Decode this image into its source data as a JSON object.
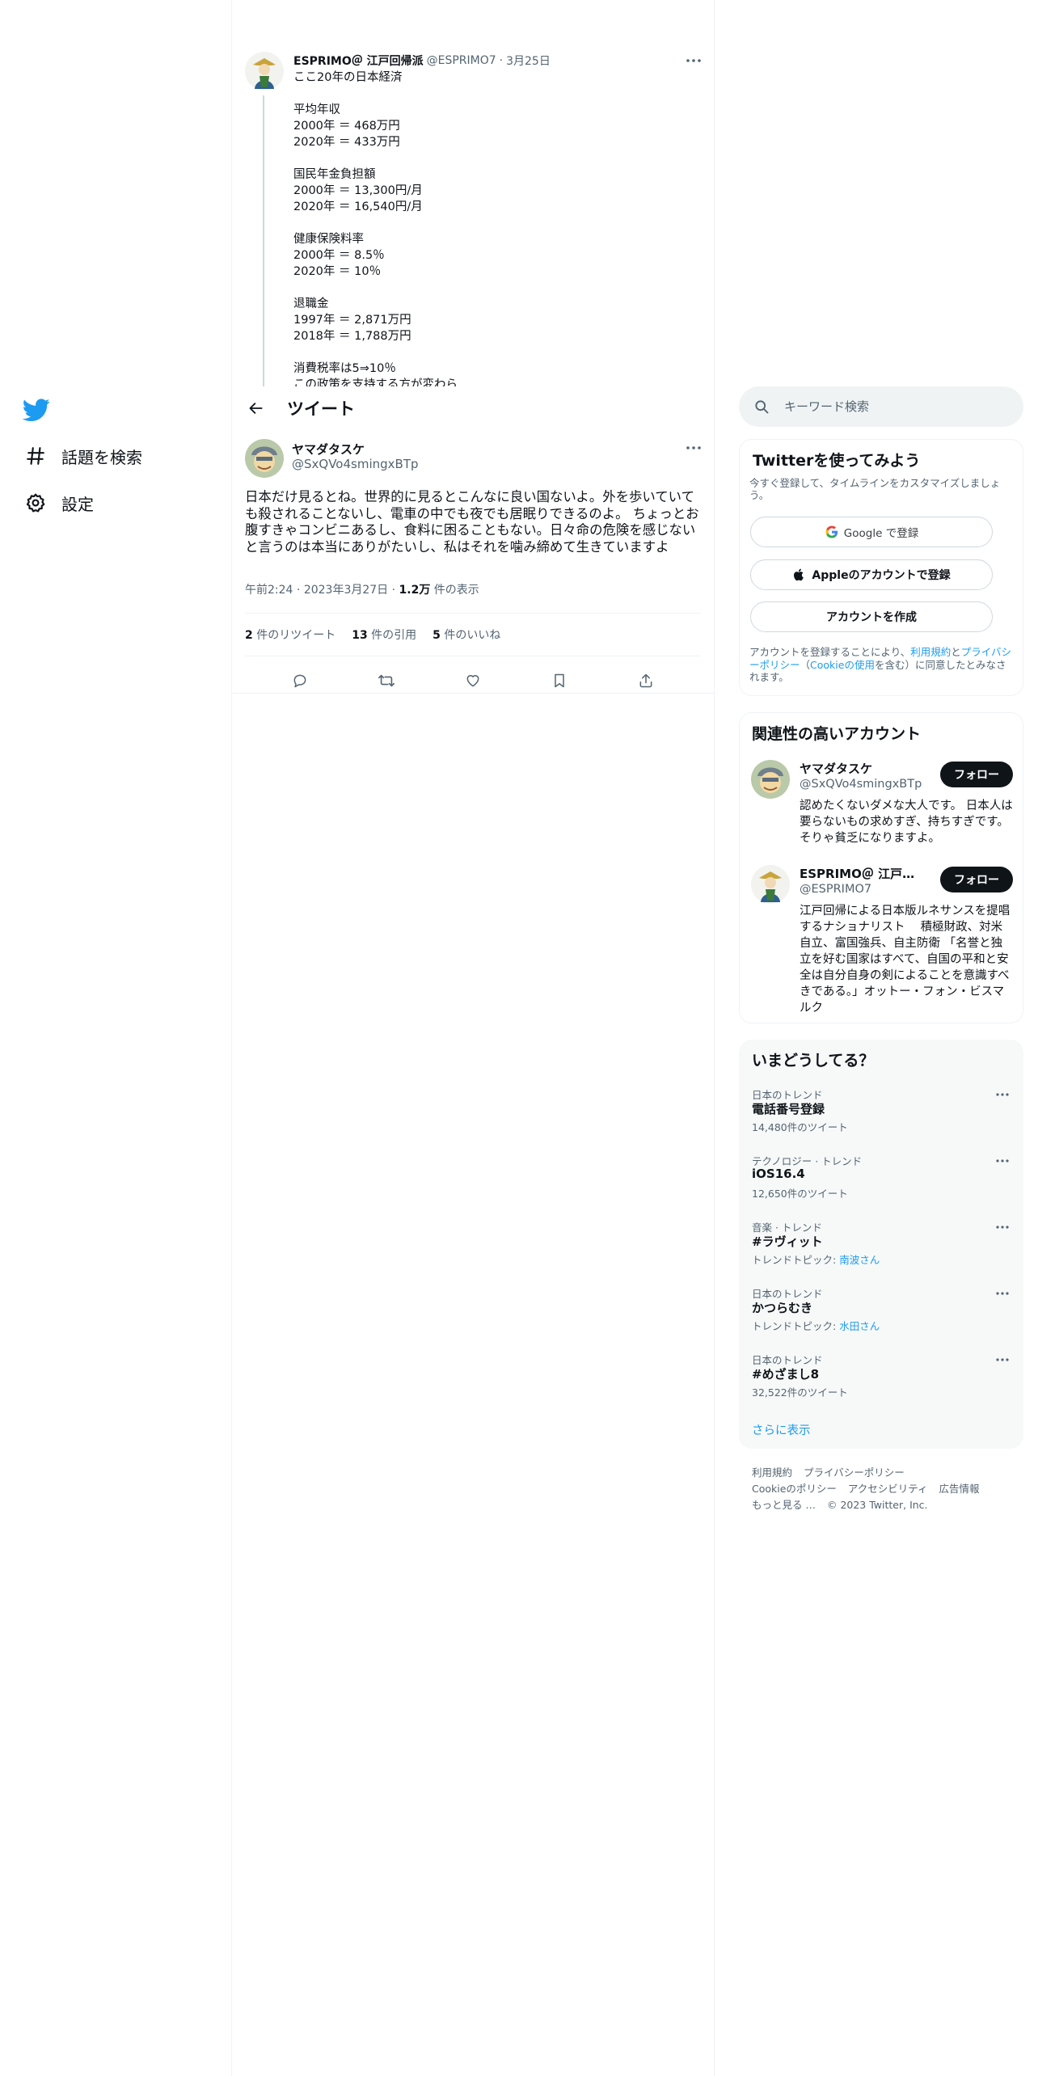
{
  "nav": {
    "items": [
      {
        "label": "話題を検索",
        "icon": "hashtag-icon"
      },
      {
        "label": "設定",
        "icon": "gear-icon"
      }
    ]
  },
  "parent_tweet": {
    "name": "ESPRIMO＠ 江戸回帰派",
    "handle": "@ESPRIMO7",
    "sep": "·",
    "date": "3月25日",
    "text": "ここ20年の日本経済\n\n平均年収\n2000年 ＝ 468万円\n2020年 ＝ 433万円\n\n国民年金負担額\n2000年 ＝ 13,300円/月\n2020年 ＝ 16,540円/月\n\n健康保険料率\n2000年 ＝ 8.5％\n2020年 ＝ 10％\n\n退職金\n1997年 ＝ 2,871万円\n2018年 ＝ 1,788万円\n\n消費税率は5⇒10％\nこの政策を支持する方が変わら"
  },
  "header": {
    "title": "ツイート"
  },
  "tweet": {
    "name": "ヤマダタスケ",
    "handle": "@SxQVo4smingxBTp",
    "text": "日本だけ見るとね。世界的に見るとこんなに良い国ないよ。外を歩いていても殺されることないし、電車の中でも夜でも居眠りできるのよ。 ちょっとお腹すきゃコンビニあるし、食料に困ることもない。日々命の危険を感じないと言うのは本当にありがたいし、私はそれを噛み締めて生きていますよ",
    "time": "午前2:24",
    "sep": "·",
    "date": "2023年3月27日",
    "views_count": "1.2万",
    "views_label": " 件の表示",
    "retweets_count": "2",
    "retweets_label": " 件のリツイート",
    "quotes_count": "13",
    "quotes_label": " 件の引用",
    "likes_count": "5",
    "likes_label": " 件のいいね"
  },
  "search": {
    "placeholder": "キーワード検索"
  },
  "signup": {
    "title": "Twitterを使ってみよう",
    "subtitle": "今すぐ登録して、タイムラインをカスタマイズしましょう。",
    "google_label": "Google で登録",
    "apple_label": "Appleのアカウントで登録",
    "create_label": "アカウントを作成",
    "legal_pre": "アカウントを登録することにより、",
    "legal_terms": "利用規約",
    "legal_and": "と",
    "legal_privacy": "プライバシーポリシー",
    "legal_paren_open": "（",
    "legal_cookie": "Cookieの使用",
    "legal_post": "を含む）に同意したとみなされます。"
  },
  "related": {
    "title": "関連性の高いアカウント",
    "accounts": [
      {
        "name": "ヤマダタスケ",
        "handle": "@SxQVo4smingxBTp",
        "follow": "フォロー",
        "bio": "認めたくないダメな大人です。 日本人は要らないもの求めすぎ、持ちすぎです。そりゃ貧乏になりますよ。"
      },
      {
        "name": "ESPRIMO＠ 江戸回帰派",
        "handle": "@ESPRIMO7",
        "follow": "フォロー",
        "bio": "江戸回帰による日本版ルネサンスを提唱するナショナリスト　 積極財政、対米自立、富国強兵、自主防衛 「名誉と独立を好む国家はすべて、自国の平和と安全は自分自身の剣によることを意識すべきである。」オットー・フォン・ビスマルク"
      }
    ]
  },
  "trends": {
    "title": "いまどうしてる？",
    "items": [
      {
        "context": "日本のトレンド",
        "name": "電話番号登録",
        "count": "14,480件のツイート",
        "topic": ""
      },
      {
        "context": "テクノロジー · トレンド",
        "name": "iOS16.4",
        "count": "12,650件のツイート",
        "topic": ""
      },
      {
        "context": "音楽 · トレンド",
        "name": "#ラヴィット",
        "count": "トレンドトピック: ",
        "topic": "南波さん"
      },
      {
        "context": "日本のトレンド",
        "name": "かつらむき",
        "count": "トレンドトピック: ",
        "topic": "水田さん"
      },
      {
        "context": "日本のトレンド",
        "name": "#めざまし8",
        "count": "32,522件のツイート",
        "topic": ""
      }
    ],
    "show_more": "さらに表示"
  },
  "footer": {
    "links": [
      "利用規約",
      "プライバシーポリシー",
      "Cookieのポリシー",
      "アクセシビリティ",
      "広告情報",
      "もっと見る …"
    ],
    "copyright": "© 2023 Twitter, Inc."
  },
  "colors": {
    "accent": "#1d9bf0",
    "text": "#0f1419",
    "muted": "#536471",
    "border": "#eff3f4"
  }
}
